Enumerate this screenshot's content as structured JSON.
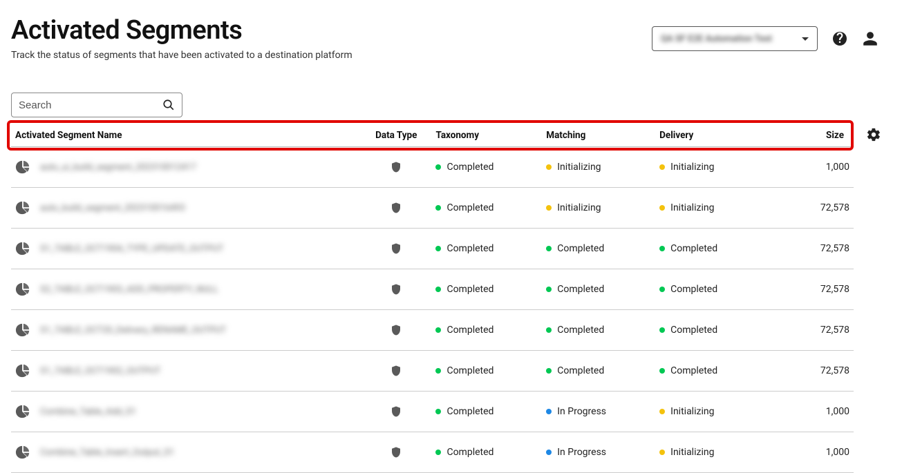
{
  "header": {
    "title": "Activated Segments",
    "subtitle": "Track the status of segments that have been activated to a destination platform",
    "account_label": "QA SF E2E Automation Test"
  },
  "search": {
    "placeholder": "Search"
  },
  "columns": {
    "name": "Activated Segment Name",
    "datatype": "Data Type",
    "taxonomy": "Taxonomy",
    "matching": "Matching",
    "delivery": "Delivery",
    "size": "Size"
  },
  "status_labels": {
    "completed": "Completed",
    "initializing": "Initializing",
    "in_progress": "In Progress"
  },
  "rows": [
    {
      "name": "auto_ui_build_segment_202310012417",
      "taxonomy": "completed",
      "matching": "initializing",
      "delivery": "initializing",
      "size": "1,000"
    },
    {
      "name": "auto_build_segment_202310016493",
      "taxonomy": "completed",
      "matching": "initializing",
      "delivery": "initializing",
      "size": "72,578"
    },
    {
      "name": "S1_TABLE_OCT1904_TYPE_UPDATE_OUTPUT",
      "taxonomy": "completed",
      "matching": "completed",
      "delivery": "completed",
      "size": "72,578"
    },
    {
      "name": "S2_TABLE_OCT1903_ADD_PROPERTY_NULL",
      "taxonomy": "completed",
      "matching": "completed",
      "delivery": "completed",
      "size": "72,578"
    },
    {
      "name": "S1_TABLE_OCT20_Delivery_RENAME_OUTPUT",
      "taxonomy": "completed",
      "matching": "completed",
      "delivery": "completed",
      "size": "72,578"
    },
    {
      "name": "S1_TABLE_OCT1902_OUTPUT",
      "taxonomy": "completed",
      "matching": "completed",
      "delivery": "completed",
      "size": "72,578"
    },
    {
      "name": "Combine_Table_Add_S1",
      "taxonomy": "completed",
      "matching": "in_progress",
      "delivery": "initializing",
      "size": "1,000"
    },
    {
      "name": "Combine_Table_Insert_Output_S1",
      "taxonomy": "completed",
      "matching": "in_progress",
      "delivery": "initializing",
      "size": "1,000"
    }
  ],
  "status_colors": {
    "completed": "green",
    "initializing": "yellow",
    "in_progress": "blue"
  }
}
